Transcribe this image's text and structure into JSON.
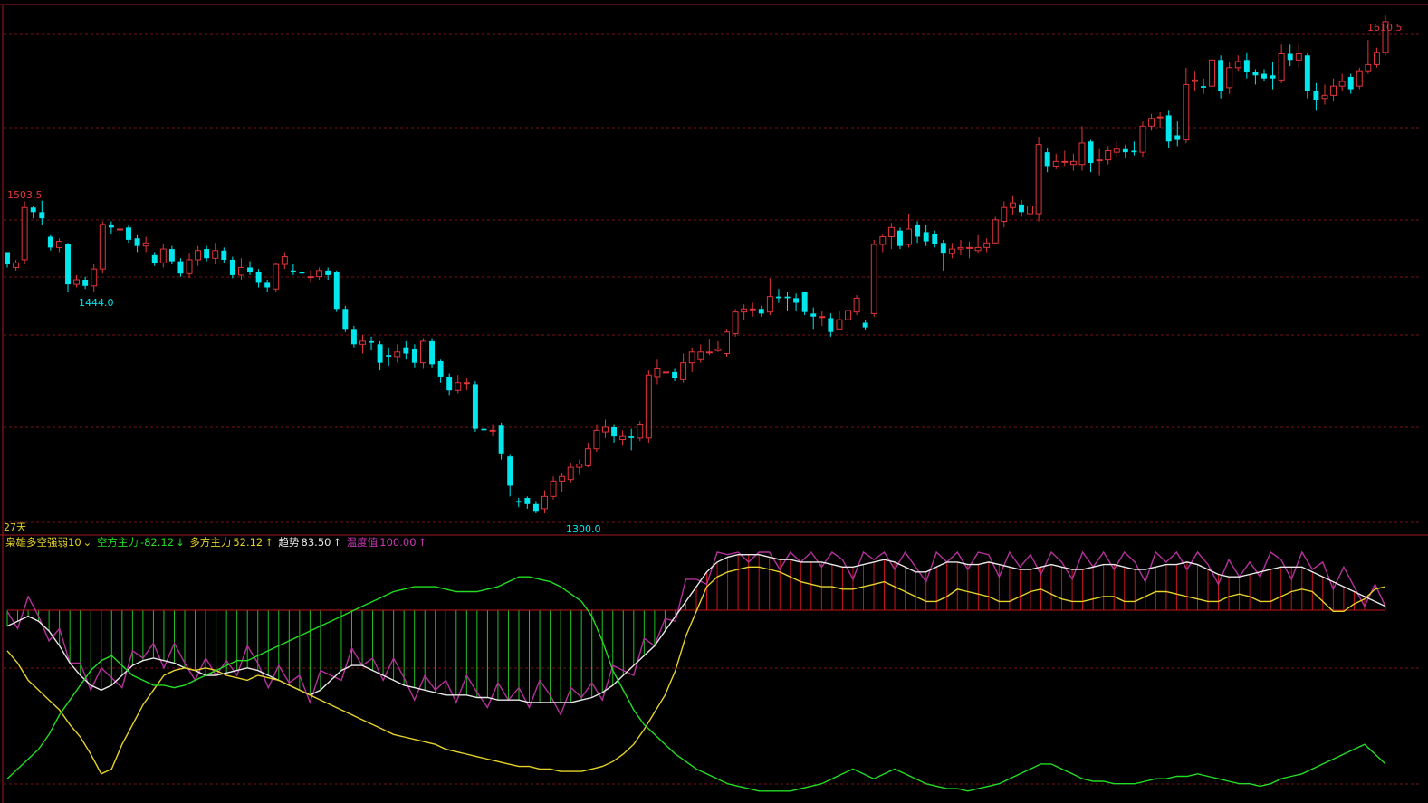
{
  "colors": {
    "background": "#000000",
    "up": "#e0353a",
    "down": "#00e8ee",
    "grid": "#7a1418",
    "frame": "#a31a20",
    "white_line": "#e8e8e8",
    "yellow_line": "#e6d22a",
    "green_line": "#22dd22",
    "magenta_line": "#b4319a",
    "hist_up": "#c8141c",
    "hist_down": "#24c024"
  },
  "price_labels": {
    "high_right": "1610.5",
    "high_left": "1503.5",
    "low_left": "1444.0",
    "low_mid": "1300.0"
  },
  "period_label": "27天",
  "indicator": {
    "name": "枭雄多空强弱10",
    "dropdown_icon": "chevron-down-icon",
    "bear_label": "空方主力",
    "bear_value": "-82.12",
    "bear_arrow": "↓",
    "bull_label": "多方主力",
    "bull_value": "52.12",
    "bull_arrow": "↑",
    "trend_label": "趋势",
    "trend_value": "83.50",
    "trend_arrow": "↑",
    "temp_label": "温度值",
    "temp_value": "100.00",
    "temp_arrow": "↑"
  },
  "chart_data": {
    "type": "candlestick",
    "price_range": [
      1291,
      1620
    ],
    "candles": [
      [
        1470,
        1462,
        1470,
        1460
      ],
      [
        1460,
        1463,
        1465,
        1458
      ],
      [
        1465,
        1499,
        1503,
        1462
      ],
      [
        1499,
        1496,
        1500,
        1492
      ],
      [
        1496,
        1492,
        1503.5,
        1488
      ],
      [
        1480,
        1473,
        1481,
        1471
      ],
      [
        1473,
        1477,
        1479,
        1470
      ],
      [
        1475,
        1449,
        1476,
        1444
      ],
      [
        1449,
        1452,
        1455,
        1447
      ],
      [
        1452,
        1448,
        1454,
        1446
      ],
      [
        1448,
        1459,
        1462,
        1444
      ],
      [
        1459,
        1488,
        1490,
        1456
      ],
      [
        1488,
        1486,
        1490,
        1482
      ],
      [
        1485,
        1485,
        1492,
        1480
      ],
      [
        1486,
        1478,
        1488,
        1476
      ],
      [
        1479,
        1474,
        1481,
        1470
      ],
      [
        1474,
        1476,
        1480,
        1470
      ],
      [
        1468,
        1463,
        1470,
        1461
      ],
      [
        1463,
        1472,
        1475,
        1460
      ],
      [
        1472,
        1464,
        1474,
        1462
      ],
      [
        1464,
        1456,
        1466,
        1454
      ],
      [
        1456,
        1465,
        1469,
        1453
      ],
      [
        1465,
        1471,
        1474,
        1461
      ],
      [
        1472,
        1466,
        1474,
        1464
      ],
      [
        1466,
        1471,
        1476,
        1462
      ],
      [
        1471,
        1465,
        1473,
        1463
      ],
      [
        1465,
        1455,
        1467,
        1453
      ],
      [
        1455,
        1460,
        1466,
        1452
      ],
      [
        1460,
        1457,
        1464,
        1455
      ],
      [
        1457,
        1450,
        1459,
        1447
      ],
      [
        1450,
        1447,
        1452,
        1444
      ],
      [
        1446,
        1462,
        1463,
        1444
      ],
      [
        1462,
        1467,
        1470,
        1459
      ],
      [
        1458,
        1457,
        1462,
        1455
      ],
      [
        1457,
        1456,
        1459,
        1452
      ],
      [
        1454,
        1454,
        1458,
        1450
      ],
      [
        1454,
        1458,
        1460,
        1452
      ],
      [
        1458,
        1455,
        1460,
        1452
      ],
      [
        1457,
        1433,
        1458,
        1431
      ],
      [
        1433,
        1420,
        1435,
        1418
      ],
      [
        1420,
        1410,
        1422,
        1408
      ],
      [
        1410,
        1412,
        1416,
        1404
      ],
      [
        1412,
        1411,
        1415,
        1406
      ],
      [
        1410,
        1398,
        1412,
        1393
      ],
      [
        1403,
        1402,
        1408,
        1396
      ],
      [
        1402,
        1405,
        1410,
        1398
      ],
      [
        1408,
        1404,
        1412,
        1400
      ],
      [
        1407,
        1398,
        1410,
        1395
      ],
      [
        1398,
        1412,
        1414,
        1394
      ],
      [
        1412,
        1397,
        1414,
        1395
      ],
      [
        1399,
        1389,
        1400,
        1385
      ],
      [
        1389,
        1380,
        1391,
        1377
      ],
      [
        1380,
        1385,
        1390,
        1378
      ],
      [
        1385,
        1385,
        1388,
        1380
      ],
      [
        1384,
        1355,
        1386,
        1353
      ],
      [
        1355,
        1354,
        1358,
        1350
      ],
      [
        1354,
        1354,
        1358,
        1350
      ],
      [
        1357,
        1339,
        1359,
        1335
      ],
      [
        1337,
        1318,
        1338,
        1311
      ],
      [
        1308,
        1307,
        1310,
        1304
      ],
      [
        1310,
        1306,
        1311,
        1303
      ],
      [
        1306,
        1301,
        1308,
        1300
      ],
      [
        1303,
        1311,
        1315,
        1300
      ],
      [
        1311,
        1321,
        1324,
        1309
      ],
      [
        1321,
        1324,
        1326,
        1314
      ],
      [
        1322,
        1330,
        1333,
        1320
      ],
      [
        1330,
        1332,
        1335,
        1325
      ],
      [
        1331,
        1342,
        1346,
        1330
      ],
      [
        1342,
        1354,
        1358,
        1340
      ],
      [
        1353,
        1356,
        1361,
        1349
      ],
      [
        1356,
        1350,
        1358,
        1346
      ],
      [
        1348,
        1350,
        1354,
        1344
      ],
      [
        1350,
        1349,
        1355,
        1341
      ],
      [
        1349,
        1358,
        1360,
        1347
      ],
      [
        1349,
        1390,
        1393,
        1346
      ],
      [
        1389,
        1394,
        1400,
        1384
      ],
      [
        1392,
        1392,
        1397,
        1386
      ],
      [
        1392,
        1388,
        1394,
        1386
      ],
      [
        1387,
        1398,
        1404,
        1385
      ],
      [
        1398,
        1405,
        1408,
        1392
      ],
      [
        1400,
        1405,
        1410,
        1398
      ],
      [
        1405,
        1405,
        1413,
        1403
      ],
      [
        1406,
        1407,
        1412,
        1405
      ],
      [
        1404,
        1418,
        1420,
        1402
      ],
      [
        1417,
        1431,
        1433,
        1415
      ],
      [
        1431,
        1433,
        1436,
        1426
      ],
      [
        1433,
        1433,
        1437,
        1428
      ],
      [
        1433,
        1430,
        1435,
        1428
      ],
      [
        1431,
        1441,
        1453,
        1429
      ],
      [
        1441,
        1440,
        1446,
        1437
      ],
      [
        1441,
        1440,
        1444,
        1432
      ],
      [
        1440,
        1437,
        1443,
        1432
      ],
      [
        1444,
        1431,
        1444,
        1429
      ],
      [
        1430,
        1428,
        1434,
        1420
      ],
      [
        1428,
        1428,
        1432,
        1422
      ],
      [
        1427,
        1418,
        1430,
        1415
      ],
      [
        1420,
        1426,
        1432,
        1419
      ],
      [
        1426,
        1432,
        1434,
        1423
      ],
      [
        1431,
        1440,
        1442,
        1429
      ],
      [
        1424,
        1421,
        1426,
        1419
      ],
      [
        1430,
        1475,
        1478,
        1428
      ],
      [
        1475,
        1480,
        1482,
        1470
      ],
      [
        1480,
        1486,
        1489,
        1472
      ],
      [
        1484,
        1474,
        1486,
        1472
      ],
      [
        1475,
        1485,
        1495,
        1473
      ],
      [
        1488,
        1480,
        1490,
        1476
      ],
      [
        1483,
        1477,
        1488,
        1474
      ],
      [
        1482,
        1475,
        1484,
        1473
      ],
      [
        1476,
        1469,
        1478,
        1458
      ],
      [
        1469,
        1472,
        1476,
        1466
      ],
      [
        1472,
        1473,
        1478,
        1468
      ],
      [
        1473,
        1473,
        1477,
        1466
      ],
      [
        1471,
        1473,
        1481,
        1469
      ],
      [
        1473,
        1476,
        1479,
        1470
      ],
      [
        1476,
        1491,
        1493,
        1475
      ],
      [
        1490,
        1499,
        1503,
        1486
      ],
      [
        1499,
        1502,
        1507,
        1494
      ],
      [
        1501,
        1496,
        1504,
        1493
      ],
      [
        1495,
        1500,
        1503,
        1490
      ],
      [
        1495,
        1540,
        1545,
        1490
      ],
      [
        1535,
        1526,
        1538,
        1522
      ],
      [
        1526,
        1529,
        1534,
        1524
      ],
      [
        1529,
        1529,
        1536,
        1526
      ],
      [
        1527,
        1529,
        1534,
        1523
      ],
      [
        1527,
        1541,
        1552,
        1523
      ],
      [
        1542,
        1528,
        1543,
        1522
      ],
      [
        1530,
        1530,
        1537,
        1520
      ],
      [
        1530,
        1536,
        1539,
        1527
      ],
      [
        1535,
        1537,
        1542,
        1532
      ],
      [
        1537,
        1535,
        1540,
        1531
      ],
      [
        1536,
        1535,
        1542,
        1533
      ],
      [
        1535,
        1552,
        1555,
        1532
      ],
      [
        1552,
        1557,
        1560,
        1549
      ],
      [
        1558,
        1558,
        1561,
        1551
      ],
      [
        1559,
        1542,
        1562,
        1538
      ],
      [
        1546,
        1543,
        1555,
        1539
      ],
      [
        1543,
        1579,
        1590,
        1541
      ],
      [
        1581,
        1582,
        1588,
        1575
      ],
      [
        1578,
        1577,
        1583,
        1573
      ],
      [
        1578,
        1595,
        1598,
        1570
      ],
      [
        1595,
        1575,
        1598,
        1570
      ],
      [
        1577,
        1590,
        1594,
        1573
      ],
      [
        1590,
        1594,
        1598,
        1588
      ],
      [
        1595,
        1587,
        1600,
        1583
      ],
      [
        1587,
        1585,
        1589,
        1579
      ],
      [
        1586,
        1583,
        1589,
        1581
      ],
      [
        1585,
        1583,
        1594,
        1576
      ],
      [
        1582,
        1599,
        1605,
        1580
      ],
      [
        1599,
        1595,
        1605,
        1591
      ],
      [
        1595,
        1599,
        1606,
        1590
      ],
      [
        1598,
        1575,
        1600,
        1570
      ],
      [
        1575,
        1569,
        1580,
        1562
      ],
      [
        1570,
        1572,
        1579,
        1566
      ],
      [
        1572,
        1578,
        1583,
        1568
      ],
      [
        1578,
        1581,
        1586,
        1575
      ],
      [
        1584,
        1576,
        1586,
        1573
      ],
      [
        1578,
        1588,
        1590,
        1576
      ],
      [
        1588,
        1592,
        1608,
        1586
      ],
      [
        1592,
        1600,
        1603,
        1590
      ],
      [
        1600,
        1620,
        1624,
        1598
      ]
    ],
    "indicator_series": {
      "yellow": [
        60,
        55,
        48,
        44,
        40,
        36,
        30,
        25,
        18,
        10,
        12,
        22,
        30,
        38,
        44,
        50,
        52,
        53,
        52,
        53,
        52,
        50,
        49,
        48,
        50,
        49,
        48,
        46,
        44,
        42,
        40,
        38,
        36,
        34,
        32,
        30,
        28,
        26,
        25,
        24,
        23,
        22,
        20,
        19,
        18,
        17,
        16,
        15,
        14,
        13,
        13,
        12,
        12,
        11,
        11,
        11,
        12,
        13,
        15,
        18,
        22,
        28,
        35,
        42,
        52,
        66,
        76,
        86,
        90,
        92,
        93,
        94,
        94,
        93,
        92,
        90,
        88,
        87,
        86,
        86,
        85,
        85,
        86,
        87,
        88,
        86,
        84,
        82,
        80,
        80,
        82,
        85,
        84,
        83,
        82,
        80,
        80,
        82,
        84,
        85,
        83,
        81,
        80,
        80,
        81,
        82,
        82,
        80,
        80,
        82,
        84,
        84,
        83,
        82,
        81,
        80,
        80,
        82,
        83,
        82,
        80,
        80,
        82,
        84,
        85,
        84,
        80,
        76,
        76,
        79,
        81,
        85,
        86
      ],
      "green": [
        8,
        12,
        16,
        20,
        26,
        34,
        40,
        46,
        52,
        56,
        58,
        54,
        50,
        48,
        46,
        46,
        45,
        46,
        48,
        50,
        52,
        54,
        56,
        56,
        58,
        60,
        62,
        64,
        66,
        68,
        70,
        72,
        74,
        76,
        78,
        80,
        82,
        84,
        85,
        86,
        86,
        86,
        85,
        84,
        84,
        84,
        85,
        86,
        88,
        90,
        90,
        89,
        88,
        86,
        83,
        80,
        74,
        64,
        52,
        44,
        36,
        30,
        26,
        22,
        18,
        15,
        12,
        10,
        8,
        6,
        5,
        4,
        3,
        3,
        3,
        3,
        4,
        5,
        6,
        8,
        10,
        12,
        10,
        8,
        10,
        12,
        10,
        8,
        6,
        5,
        4,
        4,
        3,
        4,
        5,
        6,
        8,
        10,
        12,
        14,
        14,
        12,
        10,
        8,
        7,
        7,
        6,
        6,
        6,
        7,
        8,
        8,
        9,
        9,
        10,
        9,
        8,
        7,
        6,
        6,
        5,
        6,
        8,
        9,
        10,
        12,
        14,
        16,
        18,
        20,
        22,
        18,
        14
      ],
      "white": [
        70,
        72,
        74,
        72,
        68,
        62,
        55,
        50,
        46,
        44,
        46,
        50,
        54,
        56,
        57,
        56,
        55,
        53,
        52,
        50,
        50,
        51,
        52,
        53,
        52,
        50,
        48,
        46,
        44,
        42,
        44,
        48,
        52,
        54,
        54,
        52,
        50,
        48,
        46,
        45,
        44,
        43,
        42,
        42,
        42,
        41,
        41,
        40,
        40,
        40,
        39,
        39,
        39,
        39,
        39,
        40,
        41,
        43,
        46,
        50,
        54,
        58,
        62,
        68,
        74,
        80,
        86,
        92,
        96,
        98,
        99,
        99,
        99,
        98,
        97,
        97,
        96,
        96,
        96,
        95,
        94,
        94,
        95,
        96,
        97,
        96,
        94,
        92,
        92,
        94,
        96,
        96,
        95,
        95,
        96,
        95,
        94,
        93,
        93,
        94,
        95,
        94,
        93,
        93,
        94,
        95,
        95,
        94,
        93,
        93,
        94,
        95,
        95,
        96,
        95,
        93,
        91,
        90,
        90,
        91,
        92,
        93,
        94,
        94,
        94,
        92,
        90,
        88,
        86,
        84,
        82,
        80,
        78
      ]
    }
  }
}
